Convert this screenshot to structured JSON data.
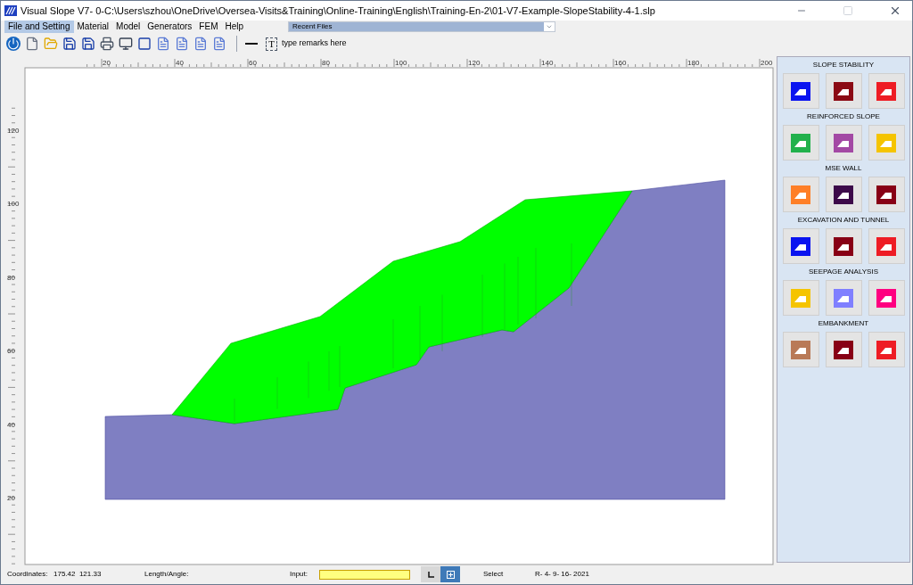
{
  "window": {
    "title": "Visual Slope V7- 0-C:\\Users\\szhou\\OneDrive\\Oversea-Visits&Training\\Online-Training\\English\\Training-En-2\\01-V7-Example-SlopeStability-4-1.slp"
  },
  "menu": [
    {
      "label": "File and Setting",
      "selected": true
    },
    {
      "label": "Material",
      "selected": false
    },
    {
      "label": "Model",
      "selected": false
    },
    {
      "label": "Generators",
      "selected": false
    },
    {
      "label": "FEM",
      "selected": false
    },
    {
      "label": "Help",
      "selected": false
    }
  ],
  "recent_files": {
    "value": "Recent Files"
  },
  "toolbar": {
    "text_tool": "T",
    "remarks": "type remarks here"
  },
  "ruler": {
    "x_labels": [
      "20",
      "40",
      "60",
      "80",
      "100",
      "120",
      "140",
      "160",
      "180",
      "200"
    ],
    "y_labels": [
      "120",
      "100",
      "80",
      "60",
      "40",
      "20"
    ]
  },
  "panel": {
    "sections": [
      {
        "title": "SLOPE STABILITY",
        "tools": [
          {
            "color": "#0a14f0"
          },
          {
            "color": "#8b0a14"
          },
          {
            "color": "#ee1c24"
          }
        ]
      },
      {
        "title": "REINFORCED SLOPE",
        "tools": [
          {
            "color": "#22b14c"
          },
          {
            "color": "#a349a4"
          },
          {
            "color": "#f5c400"
          }
        ]
      },
      {
        "title": "MSE WALL",
        "tools": [
          {
            "color": "#ff7f27"
          },
          {
            "color": "#3d0a4a"
          },
          {
            "color": "#880015"
          }
        ]
      },
      {
        "title": "EXCAVATION AND TUNNEL",
        "tools": [
          {
            "color": "#0a14f0"
          },
          {
            "color": "#880015"
          },
          {
            "color": "#ee1c24"
          }
        ]
      },
      {
        "title": "SEEPAGE ANALYSIS",
        "tools": [
          {
            "color": "#f5c400"
          },
          {
            "color": "#7f7fff"
          },
          {
            "color": "#ff0080"
          }
        ]
      },
      {
        "title": "EMBANKMENT",
        "tools": [
          {
            "color": "#b97a57"
          },
          {
            "color": "#880015"
          },
          {
            "color": "#ee1c24"
          }
        ]
      }
    ]
  },
  "status_bar": {
    "coordinates_label": "Coordinates:",
    "coordinates": "175.42  121.33",
    "length_label": "Length/Angle:",
    "input_label": "Input:",
    "mode": "Select",
    "date": "R- 4- 9- 16- 2021"
  }
}
